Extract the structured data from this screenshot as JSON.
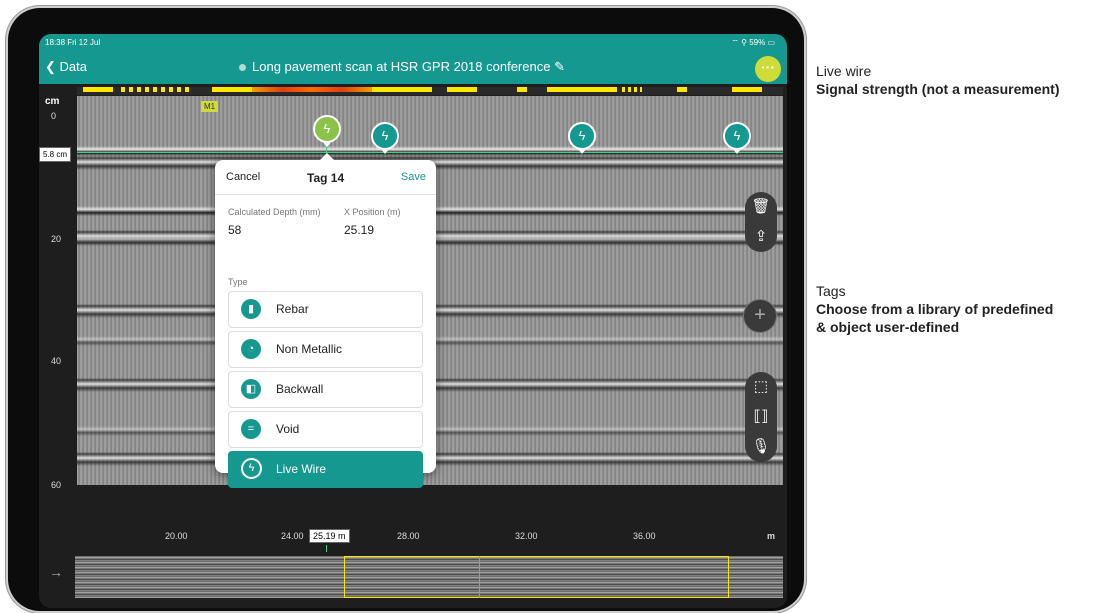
{
  "status": {
    "time": "18:38 Fri 12 Jul",
    "system": "59%"
  },
  "nav": {
    "back_label": "Data",
    "title": "Long pavement scan at HSR GPR 2018 conference",
    "more_label": "···"
  },
  "depth_axis": {
    "unit": "cm",
    "ticks": [
      "0",
      "20",
      "40",
      "60"
    ],
    "cursor_depth": "5.8 cm"
  },
  "x_axis": {
    "unit": "m",
    "ticks": [
      "20.00",
      "24.00",
      "28.00",
      "32.00",
      "36.00"
    ],
    "cursor_position": "25.19 m"
  },
  "marker": {
    "label": "M1"
  },
  "tag_pins": [
    {
      "icon": "lightning-icon",
      "active": true
    },
    {
      "icon": "lightning-icon"
    },
    {
      "icon": "lightning-icon"
    },
    {
      "icon": "lightning-icon"
    }
  ],
  "popup": {
    "cancel": "Cancel",
    "title": "Tag 14",
    "save": "Save",
    "depth_label": "Calculated Depth (mm)",
    "depth_value": "58",
    "xpos_label": "X Position (m)",
    "xpos_value": "25.19",
    "type_label": "Type",
    "options": [
      {
        "label": "Rebar",
        "icon": "rebar-icon"
      },
      {
        "label": "Non Metallic",
        "icon": "non-metallic-icon"
      },
      {
        "label": "Backwall",
        "icon": "backwall-icon"
      },
      {
        "label": "Void",
        "icon": "void-icon"
      },
      {
        "label": "Live Wire",
        "icon": "lightning-icon",
        "selected": true
      }
    ]
  },
  "tools": {
    "top": [
      "trash-icon",
      "share-icon"
    ],
    "add": "+",
    "bottom": [
      "select-icon",
      "split-icon",
      "mic-icon"
    ]
  },
  "captions": {
    "live_wire_title": "Live wire",
    "live_wire_desc": "Signal strength (not a measurement)",
    "tags_title": "Tags",
    "tags_desc_1": "Choose from a library of predefined",
    "tags_desc_2": "& object user-defined"
  },
  "colors": {
    "teal": "#15988f",
    "accent": "#cddc39",
    "cursor": "#37d47f"
  }
}
